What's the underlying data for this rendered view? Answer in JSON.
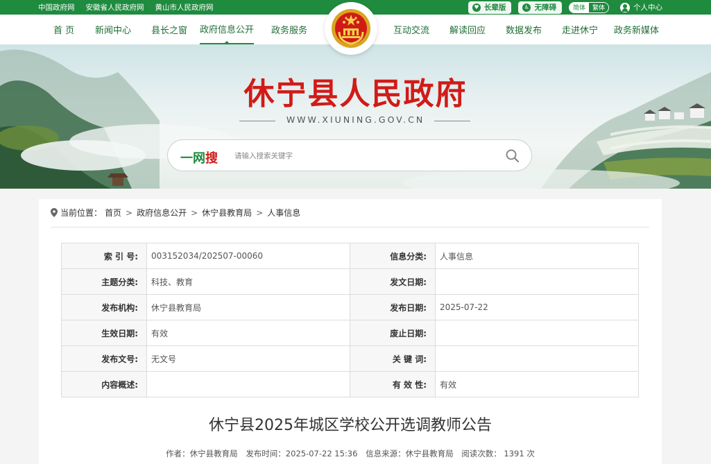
{
  "topbar": {
    "links": [
      "中国政府网",
      "安徽省人民政府网",
      "黄山市人民政府网"
    ],
    "elder_label": "长辈版",
    "access_label": "无障碍",
    "lang_simplified": "简体",
    "lang_traditional": "繁体",
    "user_center": "个人中心"
  },
  "nav": {
    "items": [
      "首 页",
      "新闻中心",
      "县长之窗",
      "政府信息公开",
      "政务服务",
      "互动交流",
      "解读回应",
      "数据发布",
      "走进休宁",
      "政务新媒体"
    ],
    "active_index": 3
  },
  "banner": {
    "title": "休宁县人民政府",
    "url": "WWW.XIUNING.GOV.CN",
    "search_logo_green": "一网",
    "search_logo_red": "搜",
    "search_placeholder": "请输入搜索关键字"
  },
  "breadcrumb": {
    "prefix": "当前位置：",
    "items": [
      "首页",
      "政府信息公开",
      "休宁县教育局",
      "人事信息"
    ]
  },
  "meta": {
    "rows": [
      [
        "索 引 号:",
        "003152034/202507-00060",
        "信息分类:",
        "人事信息"
      ],
      [
        "主题分类:",
        "科技、教育",
        "发文日期:",
        ""
      ],
      [
        "发布机构:",
        "休宁县教育局",
        "发布日期:",
        "2025-07-22"
      ],
      [
        "生效日期:",
        "有效",
        "废止日期:",
        ""
      ],
      [
        "发布文号:",
        "无文号",
        "关 键 词:",
        ""
      ],
      [
        "内容概述:",
        "",
        "有 效 性:",
        "有效"
      ]
    ]
  },
  "article": {
    "title": "休宁县2025年城区学校公开选调教师公告",
    "author": "作者：休宁县教育局",
    "publish_time": "发布时间：2025-07-22 15:36",
    "source": "信息来源：休宁县教育局",
    "views": "阅读次数： 1391 次"
  },
  "colors": {
    "brand_green": "#1f8b3f",
    "title_red": "#d11b17"
  }
}
